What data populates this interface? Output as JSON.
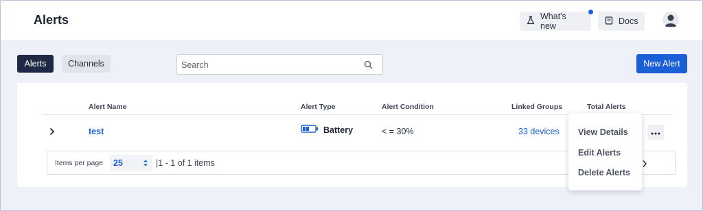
{
  "header": {
    "title": "Alerts",
    "whats_new_label": "What's new",
    "docs_label": "Docs"
  },
  "toolbar": {
    "tabs": [
      {
        "label": "Alerts",
        "active": true
      },
      {
        "label": "Channels",
        "active": false
      }
    ],
    "search_placeholder": "Search",
    "new_alert_label": "New Alert"
  },
  "table": {
    "columns": [
      "Alert Name",
      "Alert Type",
      "Alert Condition",
      "Linked Groups",
      "Total Alerts"
    ],
    "rows": [
      {
        "alert_name": "test",
        "alert_type": "Battery",
        "alert_condition": "< = 30%",
        "linked_groups": "33 devices"
      }
    ]
  },
  "pagination": {
    "items_per_page_label": "Items per page",
    "items_per_page": "25",
    "range_text": "|1 - 1 of 1 items"
  },
  "row_menu": {
    "items": [
      "View Details",
      "Edit Alerts",
      "Delete Alerts"
    ]
  },
  "colors": {
    "accent": "#1a5fd6",
    "active_tab": "#1e2a45",
    "background": "#eef1f7"
  },
  "icons": {
    "whats_new": "flask-icon",
    "docs": "book-icon",
    "avatar": "user-avatar-icon",
    "search": "search-icon",
    "expand": "chevron-right-icon",
    "battery": "battery-icon",
    "more": "more-horizontal-icon",
    "select": "updown-caret-icon",
    "next": "chevron-right-icon"
  }
}
